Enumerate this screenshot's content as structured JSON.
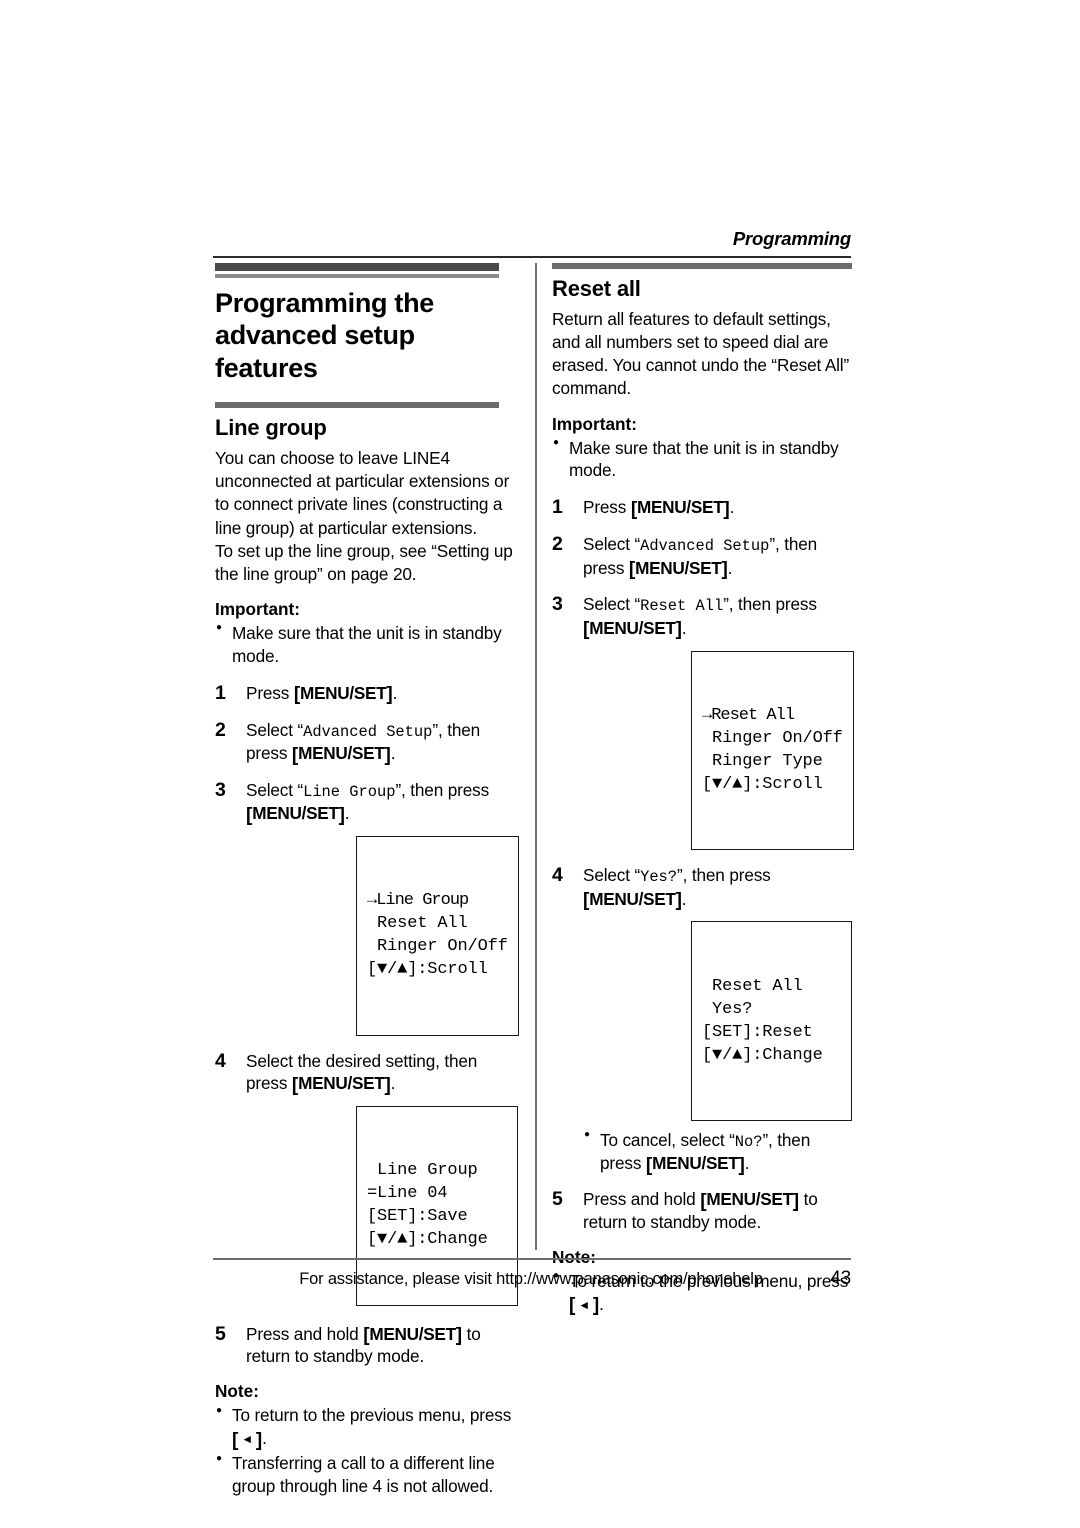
{
  "running_head": "Programming",
  "left_column": {
    "chapter_title": "Programming the advanced setup features",
    "section_title": "Line group",
    "intro": "You can choose to leave LINE4 unconnected at particular extensions or to connect private lines (constructing a line group) at particular extensions.\nTo set up the line group, see “Setting up the line group” on page 20.",
    "important_label": "Important:",
    "important_bullets": [
      "Make sure that the unit is in standby mode."
    ],
    "steps": [
      {
        "num": "1",
        "pre": "Press ",
        "key1": "MENU/SET",
        "post": "."
      },
      {
        "num": "2",
        "pre": "Select “",
        "mono": "Advanced Setup",
        "mid": "”, then press ",
        "key1": "MENU/SET",
        "post": "."
      },
      {
        "num": "3",
        "pre": "Select “",
        "mono": "Line Group",
        "mid": "”, then press ",
        "key1": "MENU/SET",
        "post": "."
      },
      {
        "num": "4",
        "pre": "Select the desired setting, then press ",
        "key1": "MENU/SET",
        "post": "."
      },
      {
        "num": "5",
        "pre": "Press and hold ",
        "key1": "MENU/SET",
        "post": " to return to standby mode."
      }
    ],
    "lcd1": {
      "line1": "→Line Group",
      "line2": " Reset All",
      "line3": " Ringer On/Off",
      "line4": "[▼/▲]:Scroll"
    },
    "lcd2": {
      "line1": " Line Group",
      "line2": "=Line 04",
      "line3": "[SET]:Save",
      "line4": "[▼/▲]:Change"
    },
    "note_label": "Note:",
    "note_bullets": [
      {
        "pre": "To return to the previous menu, press ",
        "key_tri": "◄",
        "post": "."
      },
      {
        "pre": "Transferring a call to a different line group through line 4 is not allowed.",
        "post": ""
      }
    ]
  },
  "right_column": {
    "section_title": "Reset all",
    "intro": "Return all features to default settings, and all numbers set to speed dial are erased. You cannot undo the “Reset All” command.",
    "important_label": "Important:",
    "important_bullets": [
      "Make sure that the unit is in standby mode."
    ],
    "steps": [
      {
        "num": "1",
        "pre": "Press ",
        "key1": "MENU/SET",
        "post": "."
      },
      {
        "num": "2",
        "pre": "Select “",
        "mono": "Advanced Setup",
        "mid": "”, then press ",
        "key1": "MENU/SET",
        "post": "."
      },
      {
        "num": "3",
        "pre": "Select “",
        "mono": "Reset All",
        "mid": "”, then press ",
        "key1": "MENU/SET",
        "post": "."
      },
      {
        "num": "4",
        "pre": "Select “",
        "mono": "Yes?",
        "mid": "”, then press ",
        "key1": "MENU/SET",
        "post": "."
      },
      {
        "num": "5",
        "pre": "Press and hold ",
        "key1": "MENU/SET",
        "post": " to return to standby mode."
      }
    ],
    "lcd1": {
      "line1": "→Reset All",
      "line2": " Ringer On/Off",
      "line3": " Ringer Type",
      "line4": "[▼/▲]:Scroll"
    },
    "lcd2": {
      "line1": " Reset All",
      "line2": " Yes?",
      "line3": "[SET]:Reset",
      "line4": "[▼/▲]:Change"
    },
    "cancel_bullet": {
      "pre": "To cancel, select “",
      "mono": "No?",
      "mid": "”, then press ",
      "key1": "MENU/SET",
      "post": "."
    },
    "note_label": "Note:",
    "note_bullets": [
      {
        "pre": "To return to the previous menu, press ",
        "key_tri": "◄",
        "post": "."
      }
    ]
  },
  "footer": {
    "text": "For assistance, please visit http://www.panasonic.com/phonehelp",
    "page_number": "43"
  }
}
